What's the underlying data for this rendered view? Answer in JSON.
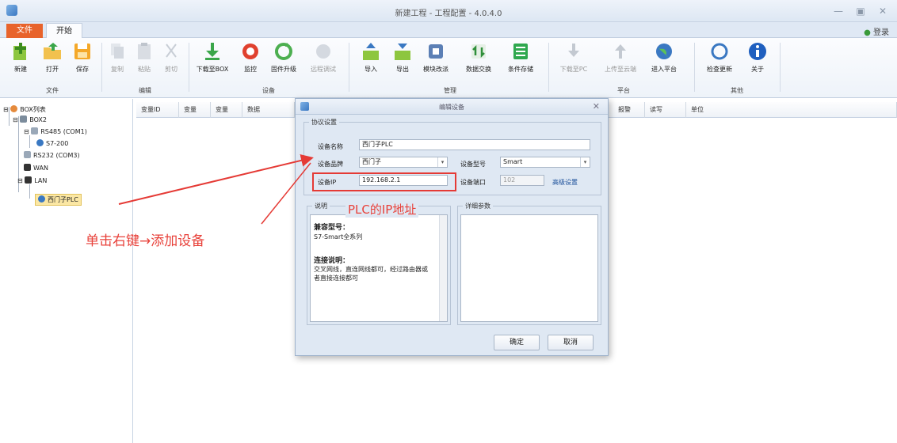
{
  "window": {
    "title": "新建工程 - 工程配置 - 4.0.4.0",
    "controls": [
      "—",
      "▣",
      "✕"
    ]
  },
  "tabs": {
    "file": "文件",
    "start": "开始",
    "login": "登录"
  },
  "ribbon": {
    "groups": {
      "file": "文件",
      "edit": "编辑",
      "device": "设备",
      "manage": "管理",
      "platform": "平台",
      "other": "其他"
    },
    "buttons": {
      "new": "新建",
      "open": "打开",
      "save": "保存",
      "copy": "复制",
      "paste": "粘贴",
      "cut": "剪切",
      "download_box": "下载至BOX",
      "online": "监控",
      "firmware": "固件升级",
      "remote": "远程调试",
      "import": "导入",
      "export": "导出",
      "module": "模块改派",
      "data_exchange": "数据交换",
      "condition_store": "条件存储",
      "download_pc": "下载至PC",
      "upload_cloud": "上传至云端",
      "enter_platform": "进入平台",
      "check_update": "检查更新",
      "about": "关于"
    }
  },
  "tree": {
    "root": "BOX列表",
    "box": "BOX2",
    "rs485": "RS485 (COM1)",
    "s7_200": "S7-200",
    "rs232": "RS232 (COM3)",
    "wan": "WAN",
    "lan": "LAN",
    "plc": "西门子PLC"
  },
  "grid": {
    "columns": [
      "变量ID",
      "变量",
      "变量",
      "数据",
      "报警",
      "读写",
      "单位"
    ]
  },
  "dialog": {
    "title": "编辑设备",
    "close": "✕",
    "protocol_group": "协议设置",
    "name_label": "设备名称",
    "name_value": "西门子PLC",
    "brand_label": "设备品牌",
    "brand_value": "西门子",
    "model_label": "设备型号",
    "model_value": "Smart",
    "ip_label": "设备IP",
    "ip_value": "192.168.2.1",
    "port_label": "设备端口",
    "port_value": "102",
    "advanced": "高级设置",
    "desc_group": "说明",
    "params_group": "详细参数",
    "compat_title": "兼容型号：",
    "compat_value": "S7-Smart全系列",
    "conn_title": "连接说明：",
    "conn_value": "交叉网线，直连网线都可，经过路由器或者直接连接都可",
    "ok": "确定",
    "cancel": "取消"
  },
  "annotations": {
    "ip_note": "PLC的IP地址",
    "right_click_note": "单击右键→添加设备"
  },
  "colors": {
    "accent_orange": "#e8632b",
    "annotation_red": "#e8413a",
    "ribbon_bg": "#eef3f9"
  },
  "icons": {
    "new": "plus-document-icon",
    "open": "folder-open-icon",
    "save": "floppy-disk-icon",
    "download_box": "download-arrow-icon",
    "online": "monitor-ring-icon",
    "firmware": "refresh-icon",
    "import": "import-icon",
    "export": "export-icon",
    "about": "info-icon"
  }
}
